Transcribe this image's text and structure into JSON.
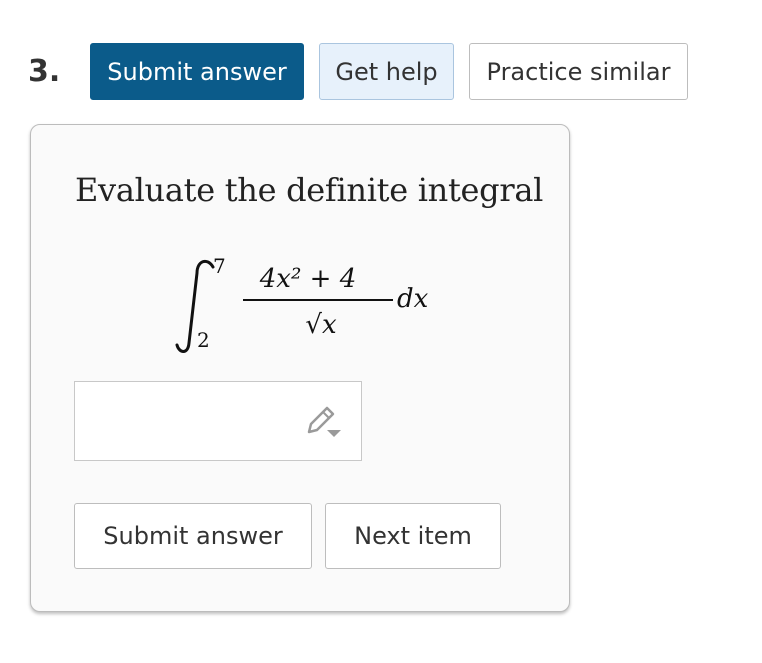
{
  "question": {
    "number": "3."
  },
  "toolbar": {
    "submit_label": "Submit answer",
    "help_label": "Get help",
    "practice_label": "Practice similar",
    "primary_color": "#0b5b8a",
    "help_bg_color": "#e7f1fb"
  },
  "problem": {
    "prompt": "Evaluate the definite integral",
    "integral": {
      "lower_limit": "2",
      "upper_limit": "7",
      "numerator": "4x² + 4",
      "denominator": "√x",
      "differential": "dx"
    }
  },
  "answer": {
    "value": "",
    "icon": "pencil-edit-icon"
  },
  "footer": {
    "submit_label": "Submit answer",
    "next_label": "Next item"
  }
}
